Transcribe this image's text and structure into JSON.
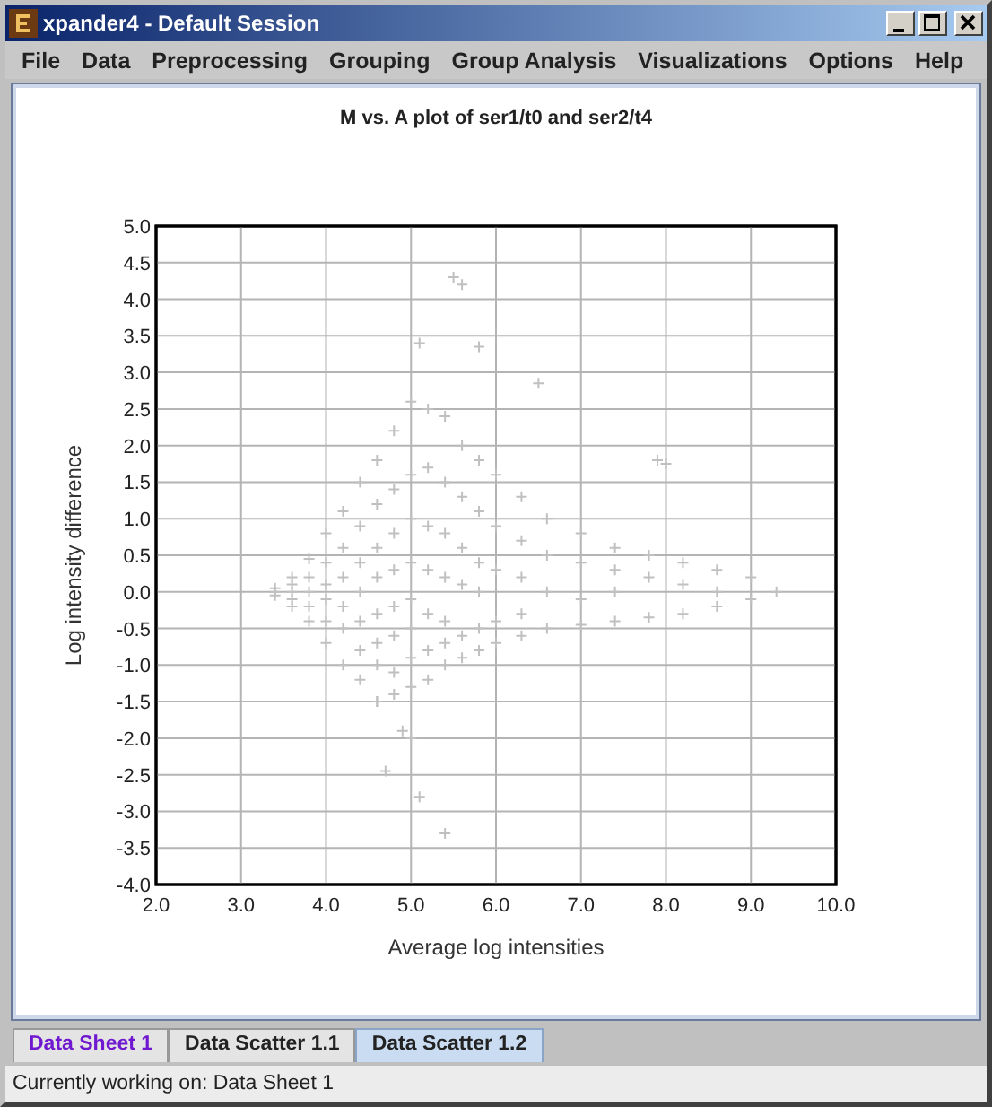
{
  "window": {
    "title": "xpander4 - Default Session"
  },
  "menu": [
    "File",
    "Data",
    "Preprocessing",
    "Grouping",
    "Group Analysis",
    "Visualizations",
    "Options",
    "Help"
  ],
  "plot": {
    "chart_data": {
      "type": "scatter",
      "grid": true,
      "title": "M vs. A plot of ser1/t0 and ser2/t4",
      "xlabel": "Average log intensities",
      "ylabel": "Log intensity difference",
      "xlim": [
        2,
        10
      ],
      "ylim": [
        -4,
        5
      ],
      "xticks": [
        {
          "value": 2,
          "label": "2.0"
        },
        {
          "value": 3,
          "label": "3.0"
        },
        {
          "value": 4,
          "label": "4.0"
        },
        {
          "value": 5,
          "label": "5.0"
        },
        {
          "value": 6,
          "label": "6.0"
        },
        {
          "value": 7,
          "label": "7.0"
        },
        {
          "value": 8,
          "label": "8.0"
        },
        {
          "value": 9,
          "label": "9.0"
        },
        {
          "value": 10,
          "label": "10.0"
        }
      ],
      "yticks": [
        {
          "value": 5,
          "label": "5.0"
        },
        {
          "value": 4.5,
          "label": "4.5"
        },
        {
          "value": 4,
          "label": "4.0"
        },
        {
          "value": 3.5,
          "label": "3.5"
        },
        {
          "value": 3,
          "label": "3.0"
        },
        {
          "value": 2.5,
          "label": "2.5"
        },
        {
          "value": 2,
          "label": "2.0"
        },
        {
          "value": 1.5,
          "label": "1.5"
        },
        {
          "value": 1,
          "label": "1.0"
        },
        {
          "value": 0.5,
          "label": "0.5"
        },
        {
          "value": 0,
          "label": "0.0"
        },
        {
          "value": -0.5,
          "label": "-0.5"
        },
        {
          "value": -1,
          "label": "-1.0"
        },
        {
          "value": -1.5,
          "label": "-1.5"
        },
        {
          "value": -2,
          "label": "-2.0"
        },
        {
          "value": -2.5,
          "label": "-2.5"
        },
        {
          "value": -3,
          "label": "-3.0"
        },
        {
          "value": -3.5,
          "label": "-3.5"
        },
        {
          "value": -4,
          "label": "-4.0"
        }
      ],
      "x": [
        3.4,
        3.4,
        3.4,
        3.6,
        3.6,
        3.6,
        3.6,
        3.6,
        3.8,
        3.8,
        3.8,
        3.8,
        3.8,
        4.0,
        4.0,
        4.0,
        4.0,
        4.0,
        4.0,
        4.2,
        4.2,
        4.2,
        4.2,
        4.2,
        4.2,
        4.4,
        4.4,
        4.4,
        4.4,
        4.4,
        4.4,
        4.4,
        4.6,
        4.6,
        4.6,
        4.6,
        4.6,
        4.6,
        4.6,
        4.6,
        4.8,
        4.8,
        4.8,
        4.8,
        4.8,
        4.8,
        4.8,
        4.8,
        5.0,
        5.0,
        5.0,
        5.0,
        5.0,
        5.0,
        5.0,
        5.0,
        5.2,
        5.2,
        5.2,
        5.2,
        5.2,
        5.2,
        5.2,
        5.4,
        5.4,
        5.4,
        5.4,
        5.4,
        5.4,
        5.4,
        5.6,
        5.6,
        5.6,
        5.6,
        5.6,
        5.6,
        5.8,
        5.8,
        5.8,
        5.8,
        5.8,
        5.8,
        6.0,
        6.0,
        6.0,
        6.0,
        6.0,
        6.3,
        6.3,
        6.3,
        6.3,
        6.3,
        6.6,
        6.6,
        6.6,
        6.6,
        7.0,
        7.0,
        7.0,
        7.0,
        7.4,
        7.4,
        7.4,
        7.4,
        7.8,
        7.8,
        7.8,
        8.2,
        8.2,
        8.2,
        8.6,
        8.6,
        8.6,
        9.0,
        9.0,
        5.5,
        5.6,
        5.1,
        5.8,
        6.5,
        4.7,
        5.1,
        5.4,
        7.9,
        8.0,
        9.3,
        4.9,
        4.6,
        5.0
      ],
      "series": [
        {
          "color": "#c0c0c0",
          "values": [
            0,
            0.05,
            -0.05,
            0.2,
            -0.2,
            0.1,
            -0.1,
            0,
            0.45,
            -0.4,
            0.2,
            -0.2,
            0,
            0.8,
            -0.7,
            0.4,
            -0.4,
            0.1,
            -0.1,
            1.1,
            -1.0,
            0.6,
            -0.5,
            0.2,
            -0.2,
            1.5,
            -1.2,
            0.9,
            -0.8,
            0.4,
            0,
            -0.4,
            1.8,
            -1.5,
            1.2,
            -1.0,
            0.6,
            0.2,
            -0.3,
            -0.7,
            2.2,
            -1.4,
            1.4,
            -1.1,
            0.8,
            0.3,
            -0.2,
            -0.6,
            2.6,
            -1.3,
            1.6,
            -0.9,
            1.0,
            0.4,
            -0.1,
            -0.5,
            2.5,
            -1.2,
            1.7,
            -0.8,
            0.9,
            0.3,
            -0.3,
            2.4,
            -1.0,
            1.5,
            -0.7,
            0.8,
            0.2,
            -0.4,
            2.0,
            -0.9,
            1.3,
            -0.6,
            0.6,
            0.1,
            1.8,
            -0.8,
            1.1,
            -0.5,
            0.4,
            0,
            1.6,
            -0.7,
            0.9,
            -0.4,
            0.3,
            1.3,
            -0.6,
            0.7,
            -0.3,
            0.2,
            1.0,
            -0.5,
            0.5,
            0,
            0.8,
            -0.45,
            0.4,
            -0.1,
            0.6,
            -0.4,
            0.3,
            0,
            0.5,
            -0.35,
            0.2,
            0.4,
            -0.3,
            0.1,
            0.3,
            -0.2,
            0,
            0.2,
            -0.1,
            4.3,
            4.2,
            3.4,
            3.35,
            2.85,
            -2.45,
            -2.8,
            -3.3,
            1.8,
            1.75,
            0,
            -1.9,
            -1.5,
            -2.0
          ]
        }
      ]
    }
  },
  "tabs": [
    {
      "label": "Data Sheet 1",
      "selected": false,
      "current": true
    },
    {
      "label": "Data Scatter 1.1",
      "selected": false,
      "current": false
    },
    {
      "label": "Data Scatter 1.2",
      "selected": true,
      "current": false
    }
  ],
  "status_bar": "Currently working on: Data Sheet 1"
}
